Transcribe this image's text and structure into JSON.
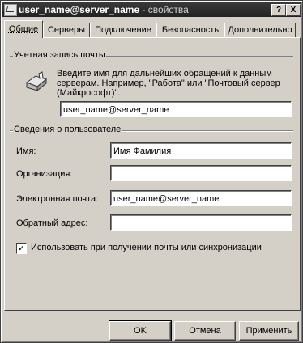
{
  "window": {
    "title_main": "user_name@server_name",
    "title_suffix": " - свойства",
    "help_glyph": "?",
    "close_glyph": "X"
  },
  "tabs": [
    {
      "label": "Общие"
    },
    {
      "label": "Серверы"
    },
    {
      "label": "Подключение"
    },
    {
      "label": "Безопасность"
    },
    {
      "label": "Дополнительно"
    }
  ],
  "account": {
    "group_label": "Учетная запись почты",
    "description": "Введите имя для дальнейших обращений к данным серверам. Например, \"Работа\" или \"Почтовый сервер (Майкрософт)\".",
    "account_name": "user_name@server_name"
  },
  "user_info": {
    "group_label": "Сведения о пользователе",
    "name_label": "Имя:",
    "name_value": "Имя Фамилия",
    "org_label": "Организация:",
    "org_value": "",
    "email_label": "Электронная почта:",
    "email_value": "user_name@server_name",
    "reply_label": "Обратный адрес:",
    "reply_value": ""
  },
  "options": {
    "include_label": "Использовать при получении почты или синхронизации",
    "include_checked": "✓"
  },
  "buttons": {
    "ok": "OK",
    "cancel": "Отмена",
    "apply": "Применить"
  }
}
